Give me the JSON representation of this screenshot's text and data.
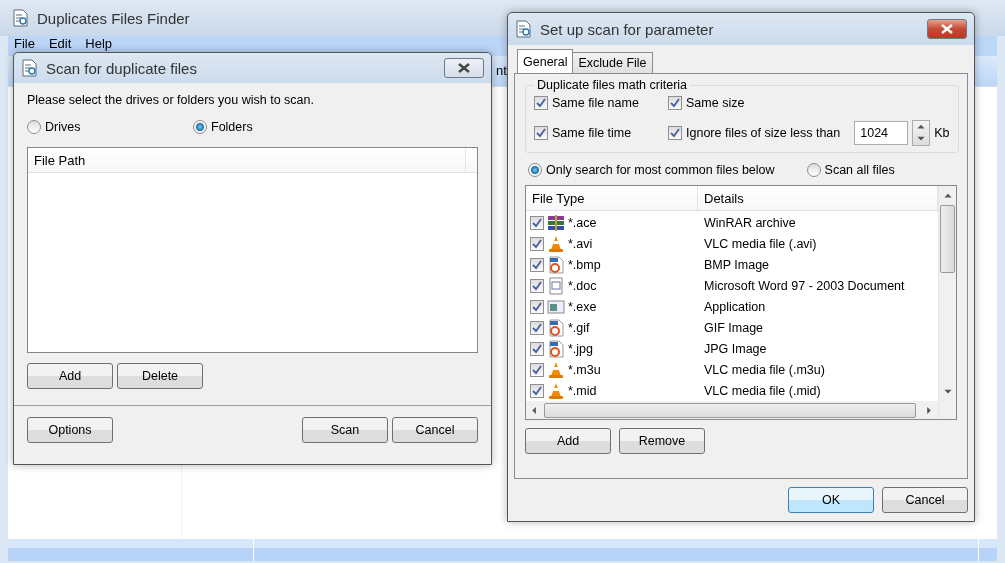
{
  "main_window": {
    "title": "Duplicates Files Finder",
    "menu": [
      "File",
      "Edit",
      "Help"
    ],
    "toolbar_fragment": "nt"
  },
  "scan_dialog": {
    "title": "Scan for duplicate files",
    "prompt": "Please select the drives or folders you wish to scan.",
    "sources": [
      {
        "label": "Drives",
        "selected": false
      },
      {
        "label": "Folders",
        "selected": true
      }
    ],
    "table": {
      "columns": [
        "File Path"
      ]
    },
    "list_buttons": [
      "Add",
      "Delete"
    ],
    "left_buttons": [
      "Options"
    ],
    "buttons": [
      "Scan",
      "Cancel"
    ]
  },
  "setup_dialog": {
    "title": "Set up scan for parameter",
    "tabs": [
      {
        "label": "General",
        "selected": true
      },
      {
        "label": "Exclude File",
        "selected": false
      }
    ],
    "criteria": {
      "title": "Duplicate files math criteria",
      "options": [
        {
          "label": "Same file name",
          "checked": true
        },
        {
          "label": "Same size",
          "checked": true
        },
        {
          "label": "Same file time",
          "checked": true
        },
        {
          "label": "Ignore files of size less than",
          "checked": true
        }
      ],
      "min_size": {
        "value": "1024",
        "unit": "Kb"
      }
    },
    "modes": [
      {
        "label": "Only search for most common files below",
        "selected": true
      },
      {
        "label": "Scan all files",
        "selected": false
      }
    ],
    "table": {
      "columns": [
        "File Type",
        "Details"
      ],
      "rows": [
        {
          "kind": "archive",
          "type": "*.ace",
          "details": "WinRAR archive",
          "checked": true
        },
        {
          "kind": "media",
          "type": "*.avi",
          "details": "VLC media file (.avi)",
          "checked": true
        },
        {
          "kind": "image",
          "type": "*.bmp",
          "details": "BMP Image",
          "checked": true
        },
        {
          "kind": "document",
          "type": "*.doc",
          "details": "Microsoft Word 97 - 2003 Document",
          "checked": true
        },
        {
          "kind": "program",
          "type": "*.exe",
          "details": "Application",
          "checked": true
        },
        {
          "kind": "image",
          "type": "*.gif",
          "details": "GIF Image",
          "checked": true
        },
        {
          "kind": "image",
          "type": "*.jpg",
          "details": "JPG Image",
          "checked": true
        },
        {
          "kind": "media",
          "type": "*.m3u",
          "details": "VLC media file (.m3u)",
          "checked": true
        },
        {
          "kind": "media",
          "type": "*.mid",
          "details": "VLC media file (.mid)",
          "checked": true
        }
      ]
    },
    "list_buttons": [
      "Add",
      "Remove"
    ],
    "buttons": [
      {
        "label": "OK",
        "default": true
      },
      {
        "label": "Cancel",
        "default": false
      }
    ]
  }
}
